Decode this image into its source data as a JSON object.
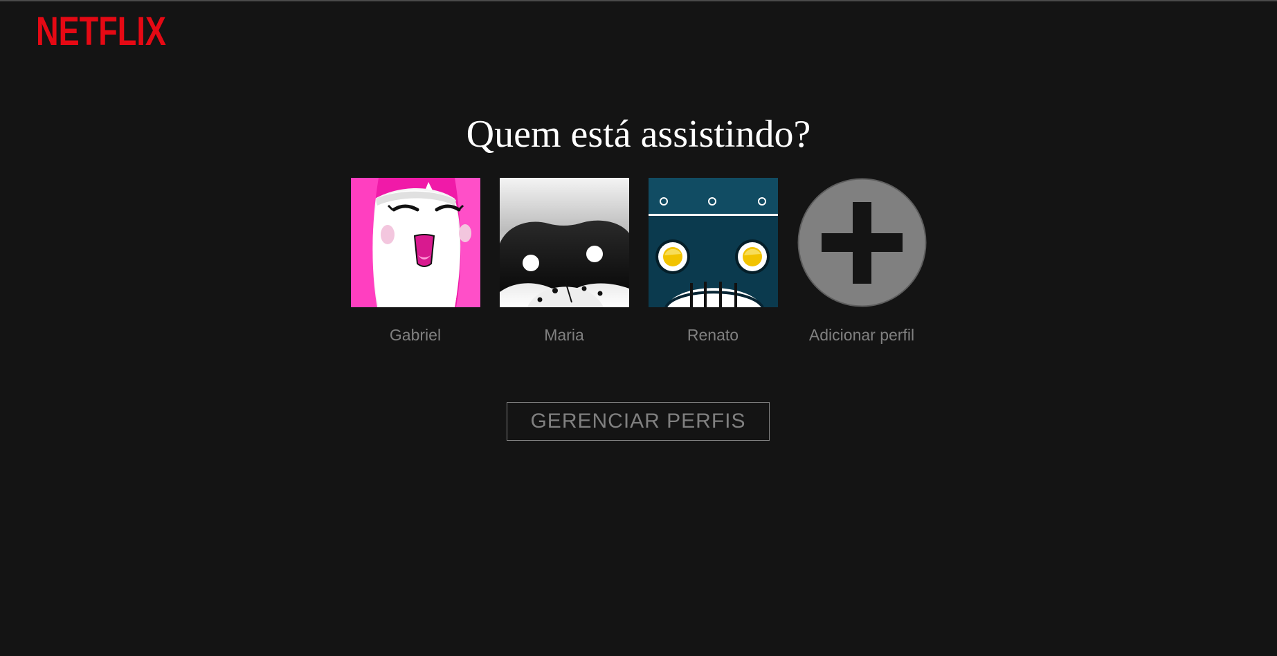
{
  "brand": {
    "logo_text": "NETFLIX",
    "color": "#e50914"
  },
  "page": {
    "title": "Quem está assistindo?",
    "background": "#141414"
  },
  "profiles": [
    {
      "name": "Gabriel",
      "avatar": "smiling-pink-character-icon",
      "color": "#f020b0"
    },
    {
      "name": "Maria",
      "avatar": "masked-raccoon-icon",
      "color": "#1a1a1a"
    },
    {
      "name": "Renato",
      "avatar": "blue-robot-icon",
      "color": "#0b3a4e"
    },
    {
      "name": "Adicionar perfil",
      "avatar": "plus-circle-icon",
      "color": "#808080"
    }
  ],
  "manage_button": {
    "label": "GERENCIAR PERFIS"
  }
}
